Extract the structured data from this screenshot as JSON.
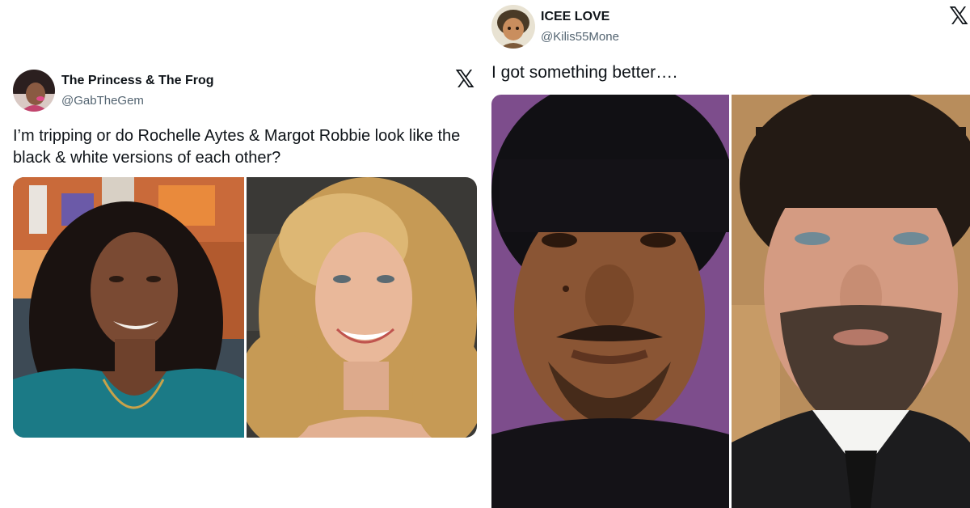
{
  "tweets": [
    {
      "display_name": "The Princess & The Frog",
      "handle": "@GabTheGem",
      "text": "I’m tripping or do Rochelle Aytes & Margot Robbie look like the black & white versions of each other?",
      "logo": "x-logo-icon"
    },
    {
      "display_name": "ICEE LOVE",
      "handle": "@Kilis55Mone",
      "text": "I got something better….",
      "logo": "x-logo-icon"
    }
  ],
  "x_logo_glyph": "𝕏",
  "colors": {
    "text_primary": "#0f1419",
    "text_secondary": "#536471",
    "background": "#ffffff"
  }
}
